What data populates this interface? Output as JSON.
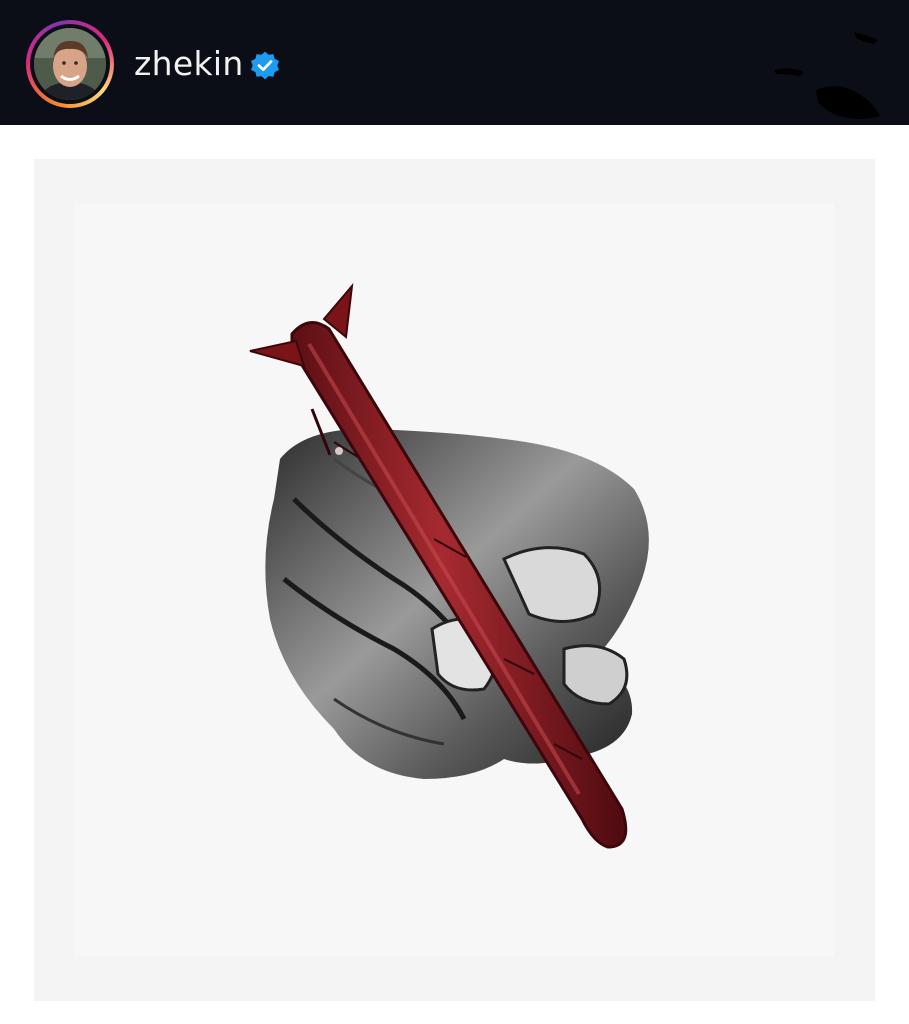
{
  "header": {
    "username": "zhekin",
    "verified": true,
    "avatar_icon": "profile-photo",
    "verified_icon": "verified-badge-icon"
  },
  "colors": {
    "header_bg": "#0c0e17",
    "verified_blue": "#1d9bf0",
    "missile_red": "#8e1f24",
    "page_bg": "#ffffff",
    "image_bg": "#f4f4f4"
  },
  "post": {
    "image_subject": "hand-holding-missile-as-pen"
  }
}
